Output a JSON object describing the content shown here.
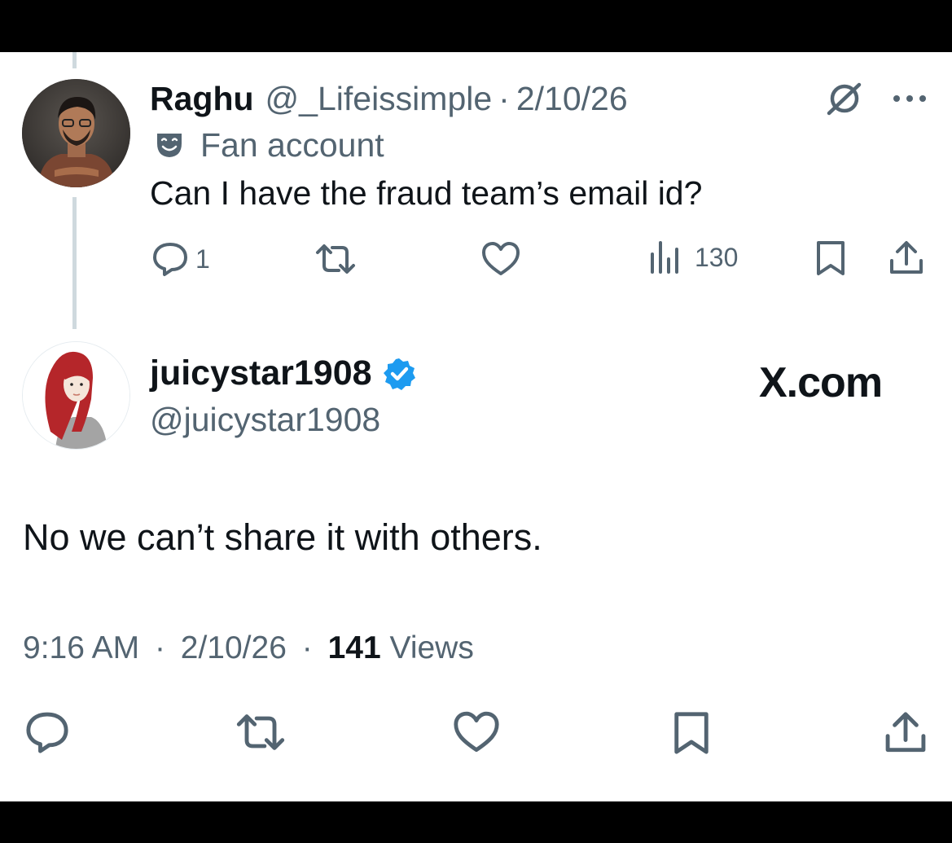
{
  "parent_tweet": {
    "author_name": "Raghu",
    "handle": "@_Lifeissimple",
    "separator": "·",
    "date": "2/10/26",
    "label_icon": "theater-masks-icon",
    "label_text": "Fan account",
    "text": "Can I have the fraud team’s email id?",
    "reply_count": "1",
    "view_count": "130"
  },
  "reply_tweet": {
    "author_name": "juicystar1908",
    "verified_badge_color": "#1d9bf0",
    "handle": "@juicystar1908",
    "brand": "X.com",
    "text": "No we can’t share it with others.",
    "time": "9:16 AM",
    "separator": "·",
    "date": "2/10/26",
    "views_count": "141",
    "views_label": "Views"
  },
  "icons": {
    "reply": "reply-bubble-icon",
    "retweet": "retweet-icon",
    "like": "heart-icon",
    "views": "bar-chart-icon",
    "bookmark": "bookmark-icon",
    "share": "share-icon",
    "grok": "grok-icon",
    "more": "more-dots-icon"
  },
  "colors": {
    "text_primary": "#0f1419",
    "text_secondary": "#536471",
    "thread_line": "#cfd9de",
    "verified": "#1d9bf0"
  }
}
